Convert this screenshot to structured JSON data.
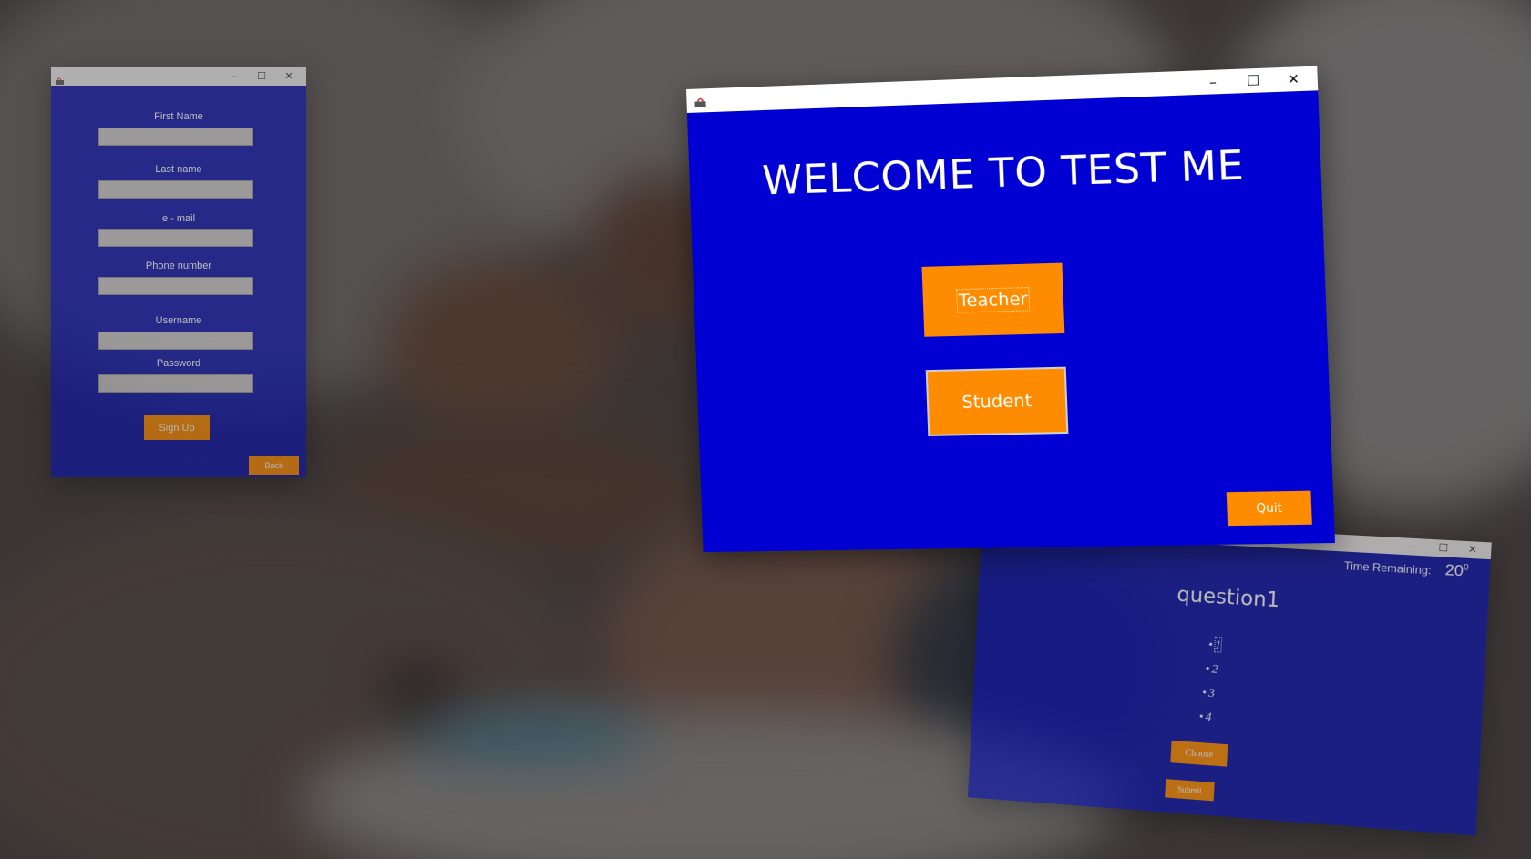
{
  "signup": {
    "fields": [
      {
        "label": "First Name"
      },
      {
        "label": "Last name"
      },
      {
        "label": "e - mail"
      },
      {
        "label": "Phone number"
      },
      {
        "label": "Username"
      },
      {
        "label": "Password"
      }
    ],
    "signup_button": "Sign Up",
    "back_button": "Back",
    "window_controls": {
      "minimize": "–",
      "maximize": "☐",
      "close": "✕"
    }
  },
  "welcome": {
    "title": "WELCOME TO TEST ME",
    "teacher_button": "Teacher",
    "student_button": "Student",
    "quit_button": "Quit",
    "window_controls": {
      "minimize": "–",
      "maximize": "☐",
      "close": "✕"
    }
  },
  "quiz": {
    "time_label": "Time Remaining:",
    "time_value": "20",
    "question": "question1",
    "options": [
      "1",
      "2",
      "3",
      "4"
    ],
    "choose_button": "Choose",
    "submit_button": "Submit",
    "window_controls": {
      "minimize": "–",
      "maximize": "☐",
      "close": "✕"
    }
  },
  "colors": {
    "window_blue": "#0000d2",
    "form_blue": "#0a12a8",
    "button_orange": "#ff8c00"
  }
}
